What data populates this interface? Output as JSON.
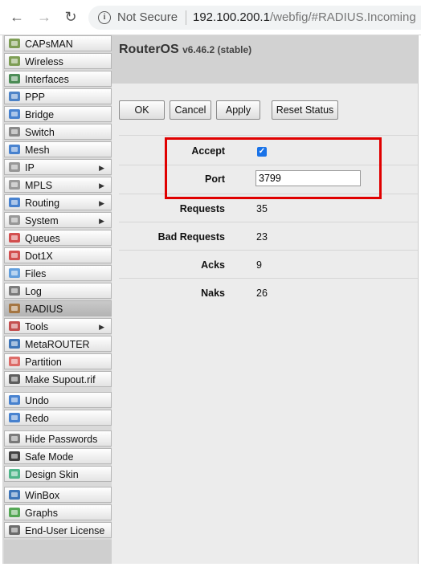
{
  "browser": {
    "security_label": "Not Secure",
    "url_host": "192.100.200.1",
    "url_path": "/webfig/#RADIUS.Incoming"
  },
  "sidebar": {
    "items": [
      {
        "label": "CAPsMAN",
        "icon": "antenna-icon",
        "arrow": false
      },
      {
        "label": "Wireless",
        "icon": "wireless-icon",
        "arrow": false
      },
      {
        "label": "Interfaces",
        "icon": "interfaces-icon",
        "arrow": false
      },
      {
        "label": "PPP",
        "icon": "ppp-icon",
        "arrow": false
      },
      {
        "label": "Bridge",
        "icon": "bridge-icon",
        "arrow": false
      },
      {
        "label": "Switch",
        "icon": "switch-icon",
        "arrow": false
      },
      {
        "label": "Mesh",
        "icon": "mesh-icon",
        "arrow": false
      },
      {
        "label": "IP",
        "icon": "ip-icon",
        "arrow": true
      },
      {
        "label": "MPLS",
        "icon": "mpls-icon",
        "arrow": true
      },
      {
        "label": "Routing",
        "icon": "routing-icon",
        "arrow": true
      },
      {
        "label": "System",
        "icon": "gear-icon",
        "arrow": true
      },
      {
        "label": "Queues",
        "icon": "queues-icon",
        "arrow": false
      },
      {
        "label": "Dot1X",
        "icon": "dot1x-icon",
        "arrow": false
      },
      {
        "label": "Files",
        "icon": "folder-icon",
        "arrow": false
      },
      {
        "label": "Log",
        "icon": "log-icon",
        "arrow": false
      },
      {
        "label": "RADIUS",
        "icon": "users-icon",
        "arrow": false,
        "active": true
      },
      {
        "label": "Tools",
        "icon": "tools-icon",
        "arrow": true
      },
      {
        "label": "MetaROUTER",
        "icon": "metarouter-icon",
        "arrow": false
      },
      {
        "label": "Partition",
        "icon": "partition-icon",
        "arrow": false
      },
      {
        "label": "Make Supout.rif",
        "icon": "document-icon",
        "arrow": false
      },
      {
        "label": "Undo",
        "icon": "undo-icon",
        "arrow": false
      },
      {
        "label": "Redo",
        "icon": "redo-icon",
        "arrow": false
      },
      {
        "label": "Hide Passwords",
        "icon": "password-icon",
        "arrow": false
      },
      {
        "label": "Safe Mode",
        "icon": "umbrella-icon",
        "arrow": false
      },
      {
        "label": "Design Skin",
        "icon": "skin-icon",
        "arrow": false
      },
      {
        "label": "WinBox",
        "icon": "winbox-icon",
        "arrow": false
      },
      {
        "label": "Graphs",
        "icon": "graph-icon",
        "arrow": false
      },
      {
        "label": "End-User License",
        "icon": "license-icon",
        "arrow": false
      }
    ]
  },
  "header": {
    "brand": "RouterOS",
    "version": "v6.46.2 (stable)"
  },
  "toolbar": {
    "ok_label": "OK",
    "cancel_label": "Cancel",
    "apply_label": "Apply",
    "reset_status_label": "Reset Status"
  },
  "form": {
    "accept_label": "Accept",
    "accept_checked": true,
    "port_label": "Port",
    "port_value": "3799",
    "requests_label": "Requests",
    "requests_value": "35",
    "bad_requests_label": "Bad Requests",
    "bad_requests_value": "23",
    "acks_label": "Acks",
    "acks_value": "9",
    "naks_label": "Naks",
    "naks_value": "26"
  },
  "colors": {
    "highlight_border": "#e00000",
    "checkbox": "#1a73e8",
    "header_band": "#d2d2d2"
  }
}
